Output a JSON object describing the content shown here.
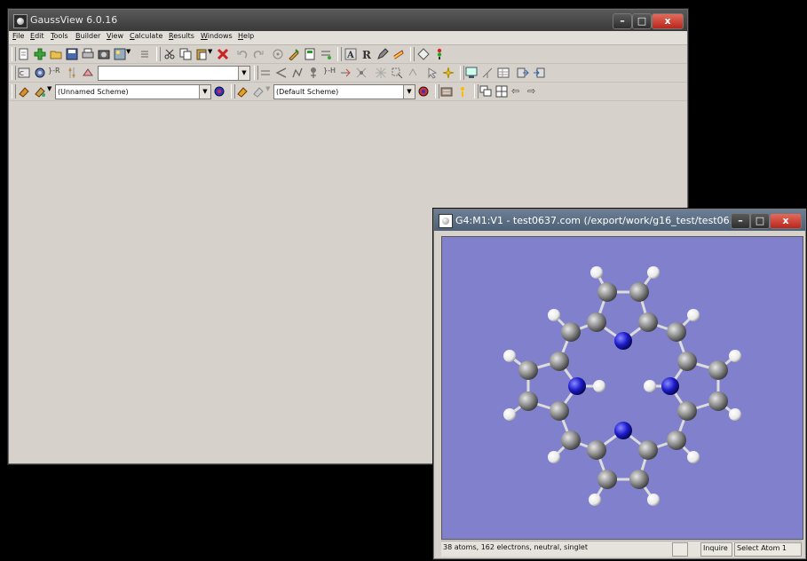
{
  "main_window": {
    "title": "GaussView 6.0.16",
    "controls": {
      "minimize": "–",
      "maximize": "□",
      "close": "x"
    },
    "menu": [
      {
        "label": "File",
        "key": "F",
        "rest": "ile"
      },
      {
        "label": "Edit",
        "key": "E",
        "rest": "dit"
      },
      {
        "label": "Tools",
        "key": "T",
        "rest": "ools"
      },
      {
        "label": "Builder",
        "key": "B",
        "rest": "uilder"
      },
      {
        "label": "View",
        "key": "V",
        "rest": "iew"
      },
      {
        "label": "Calculate",
        "key": "C",
        "rest": "alculate"
      },
      {
        "label": "Results",
        "key": "R",
        "rest": "esults"
      },
      {
        "label": "Windows",
        "key": "W",
        "rest": "indows"
      },
      {
        "label": "Help",
        "key": "H",
        "rest": "elp"
      }
    ],
    "scheme_combo_1": "(Unnamed Scheme)",
    "scheme_combo_2": "(Default Scheme)",
    "fragment_combo": ""
  },
  "molecule_window": {
    "title": "G4:M1:V1 - test0637.com (/export/work/g16_test/test06...",
    "status": "38 atoms, 162 electrons, neutral, singlet",
    "mode": "Inquire",
    "action": "Select Atom 1"
  },
  "colors": {
    "canvas_bg": "#8080cc",
    "carbon": "#7a7a7a",
    "nitrogen": "#1a1acc",
    "hydrogen": "#ffffff"
  }
}
